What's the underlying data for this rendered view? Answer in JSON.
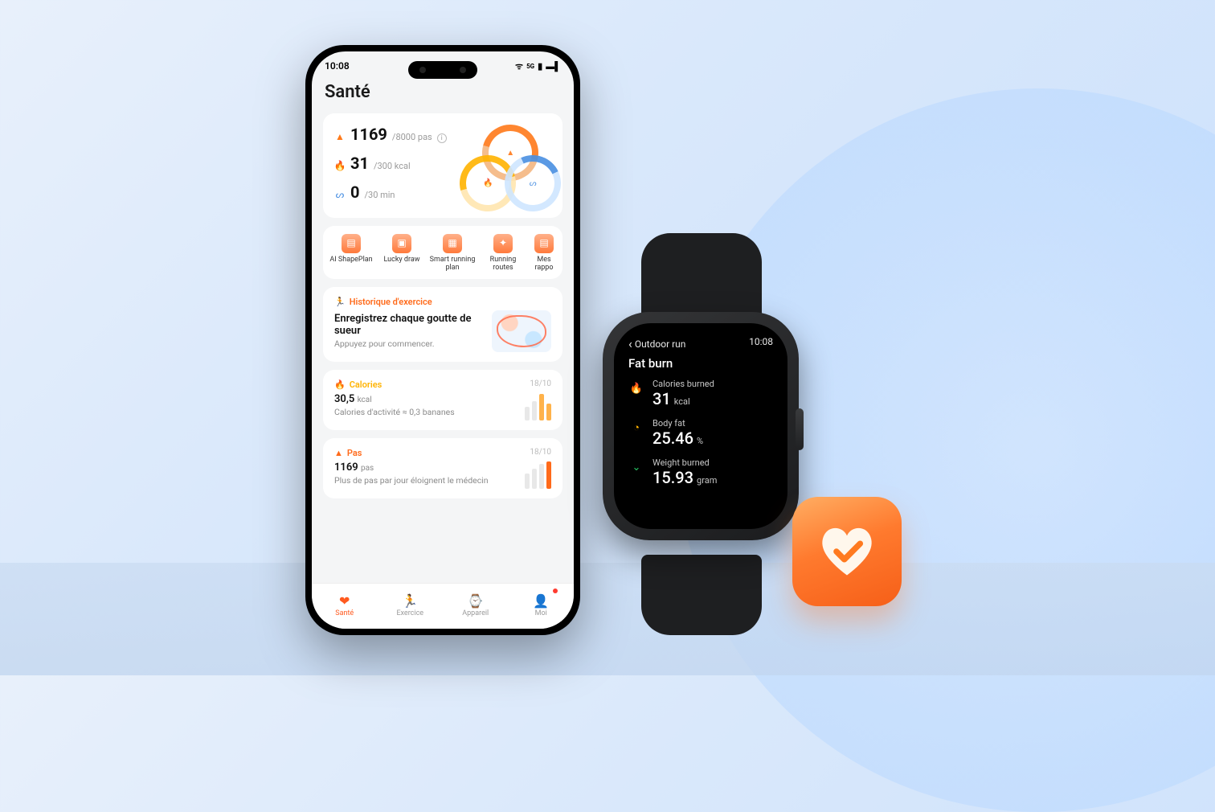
{
  "phone": {
    "statusbar": {
      "time": "10:08"
    },
    "page_title": "Santé",
    "summary": {
      "steps": {
        "value": "1169",
        "goal": "/8000 pas"
      },
      "calories": {
        "value": "31",
        "goal": "/300 kcal"
      },
      "active": {
        "value": "0",
        "goal": "/30 min"
      }
    },
    "tiles": [
      {
        "label": "AI ShapePlan"
      },
      {
        "label": "Lucky draw"
      },
      {
        "label": "Smart running plan"
      },
      {
        "label": "Running routes"
      },
      {
        "label": "Mes rappo"
      }
    ],
    "history": {
      "heading": "Historique d'exercice",
      "title": "Enregistrez chaque goutte de sueur",
      "subtitle": "Appuyez pour commencer."
    },
    "calories_card": {
      "heading": "Calories",
      "date": "18/10",
      "value": "30,5",
      "unit": "kcal",
      "subtitle": "Calories d'activité ≈ 0,3 bananes"
    },
    "steps_card": {
      "heading": "Pas",
      "date": "18/10",
      "value": "1169",
      "unit": "pas",
      "subtitle": "Plus de pas par jour éloignent le médecin"
    },
    "nav": [
      {
        "label": "Santé"
      },
      {
        "label": "Exercice"
      },
      {
        "label": "Appareil"
      },
      {
        "label": "Moi"
      }
    ]
  },
  "watch": {
    "back_label": "Outdoor run",
    "time": "10:08",
    "title": "Fat burn",
    "items": [
      {
        "label": "Calories burned",
        "value": "31",
        "unit": "kcal",
        "color": "#ff6a1a",
        "glyph": "🔥"
      },
      {
        "label": "Body fat",
        "value": "25.46",
        "unit": "%",
        "color": "#ffb300",
        "glyph": "◔"
      },
      {
        "label": "Weight burned",
        "value": "15.93",
        "unit": "gram",
        "color": "#27c765",
        "glyph": "⌄"
      }
    ]
  }
}
